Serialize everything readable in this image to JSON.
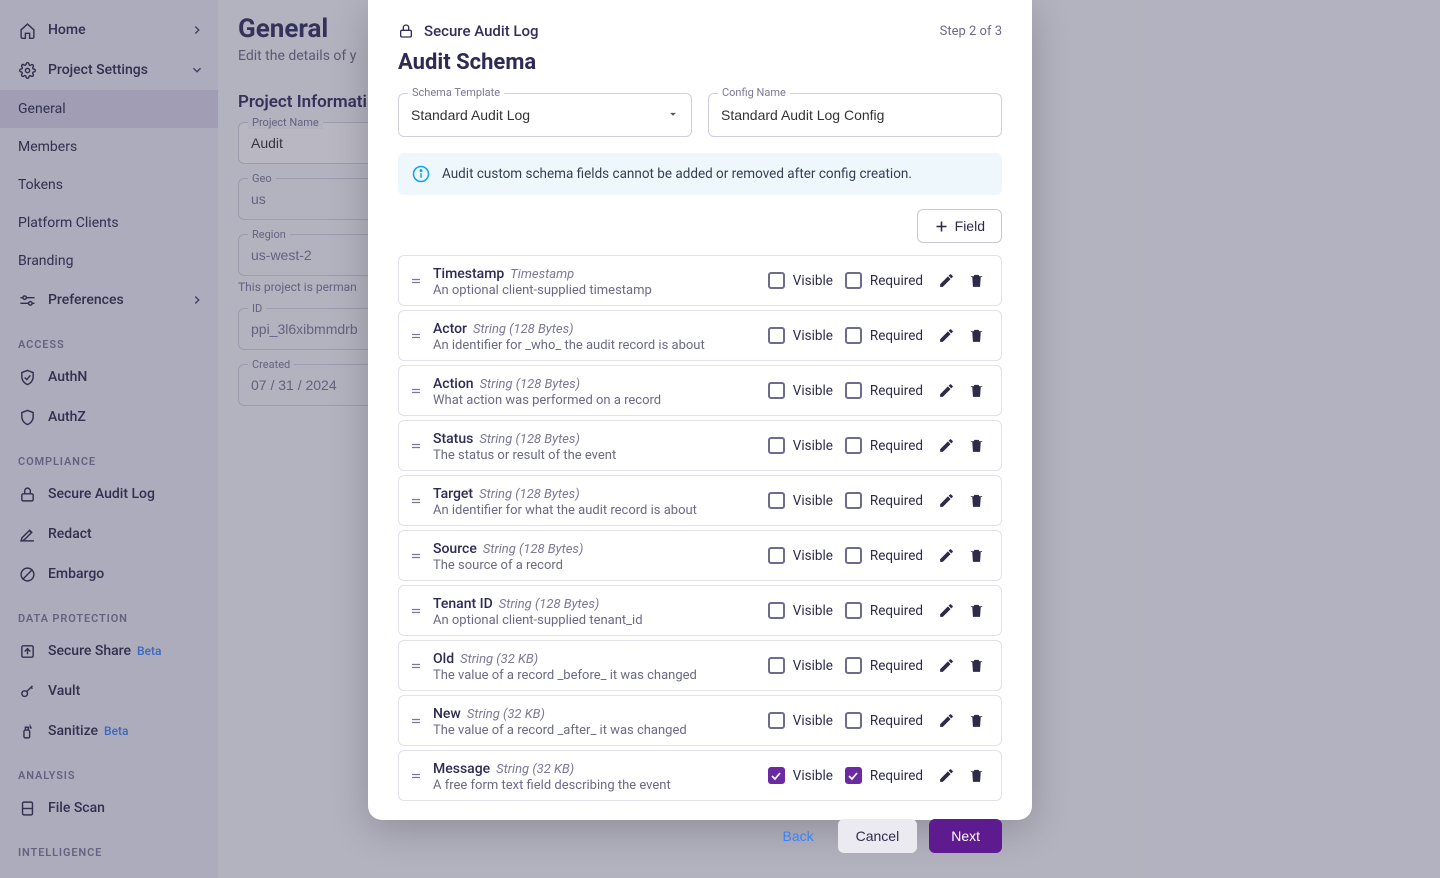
{
  "sidebar": {
    "home": "Home",
    "project_settings": "Project Settings",
    "general": "General",
    "members": "Members",
    "tokens": "Tokens",
    "platform_clients": "Platform Clients",
    "branding": "Branding",
    "preferences": "Preferences",
    "sections": {
      "access": "ACCESS",
      "compliance": "COMPLIANCE",
      "data_protection": "DATA PROTECTION",
      "analysis": "ANALYSIS",
      "intelligence": "INTELLIGENCE"
    },
    "authn": "AuthN",
    "authz": "AuthZ",
    "secure_audit_log": "Secure Audit Log",
    "redact": "Redact",
    "embargo": "Embargo",
    "secure_share": "Secure Share",
    "vault": "Vault",
    "sanitize": "Sanitize",
    "file_scan": "File Scan",
    "beta": "Beta"
  },
  "main": {
    "title": "General",
    "subtitle": "Edit the details of y",
    "section_title": "Project Informati",
    "project_name_label": "Project Name",
    "project_name_value": "Audit",
    "geo_label": "Geo",
    "geo_value": "us",
    "region_label": "Region",
    "region_value": "us-west-2",
    "region_helper": "This project is perman",
    "id_label": "ID",
    "id_value": "ppi_3l6xibmmdrb",
    "created_label": "Created",
    "created_value": "07 / 31 / 2024"
  },
  "modal": {
    "header_title": "Secure Audit Log",
    "step": "Step 2 of 3",
    "title": "Audit Schema",
    "schema_template_label": "Schema Template",
    "schema_template_value": "Standard Audit Log",
    "config_name_label": "Config Name",
    "config_name_value": "Standard Audit Log Config",
    "info": "Audit custom schema fields cannot be added or removed after config creation.",
    "add_field": "Field",
    "visible_label": "Visible",
    "required_label": "Required",
    "rows": [
      {
        "name": "Timestamp",
        "type": "Timestamp",
        "desc": "An optional client-supplied timestamp",
        "visible": false,
        "required": false
      },
      {
        "name": "Actor",
        "type": "String (128 Bytes)",
        "desc": "An identifier for _who_ the audit record is about",
        "visible": false,
        "required": false
      },
      {
        "name": "Action",
        "type": "String (128 Bytes)",
        "desc": "What action was performed on a record",
        "visible": false,
        "required": false
      },
      {
        "name": "Status",
        "type": "String (128 Bytes)",
        "desc": "The status or result of the event",
        "visible": false,
        "required": false
      },
      {
        "name": "Target",
        "type": "String (128 Bytes)",
        "desc": "An identifier for what the audit record is about",
        "visible": false,
        "required": false
      },
      {
        "name": "Source",
        "type": "String (128 Bytes)",
        "desc": "The source of a record",
        "visible": false,
        "required": false
      },
      {
        "name": "Tenant ID",
        "type": "String (128 Bytes)",
        "desc": "An optional client-supplied tenant_id",
        "visible": false,
        "required": false
      },
      {
        "name": "Old",
        "type": "String (32 KB)",
        "desc": "The value of a record _before_ it was changed",
        "visible": false,
        "required": false
      },
      {
        "name": "New",
        "type": "String (32 KB)",
        "desc": "The value of a record _after_ it was changed",
        "visible": false,
        "required": false
      },
      {
        "name": "Message",
        "type": "String (32 KB)",
        "desc": "A free form text field describing the event",
        "visible": true,
        "required": true
      }
    ],
    "back": "Back",
    "cancel": "Cancel",
    "next": "Next"
  }
}
